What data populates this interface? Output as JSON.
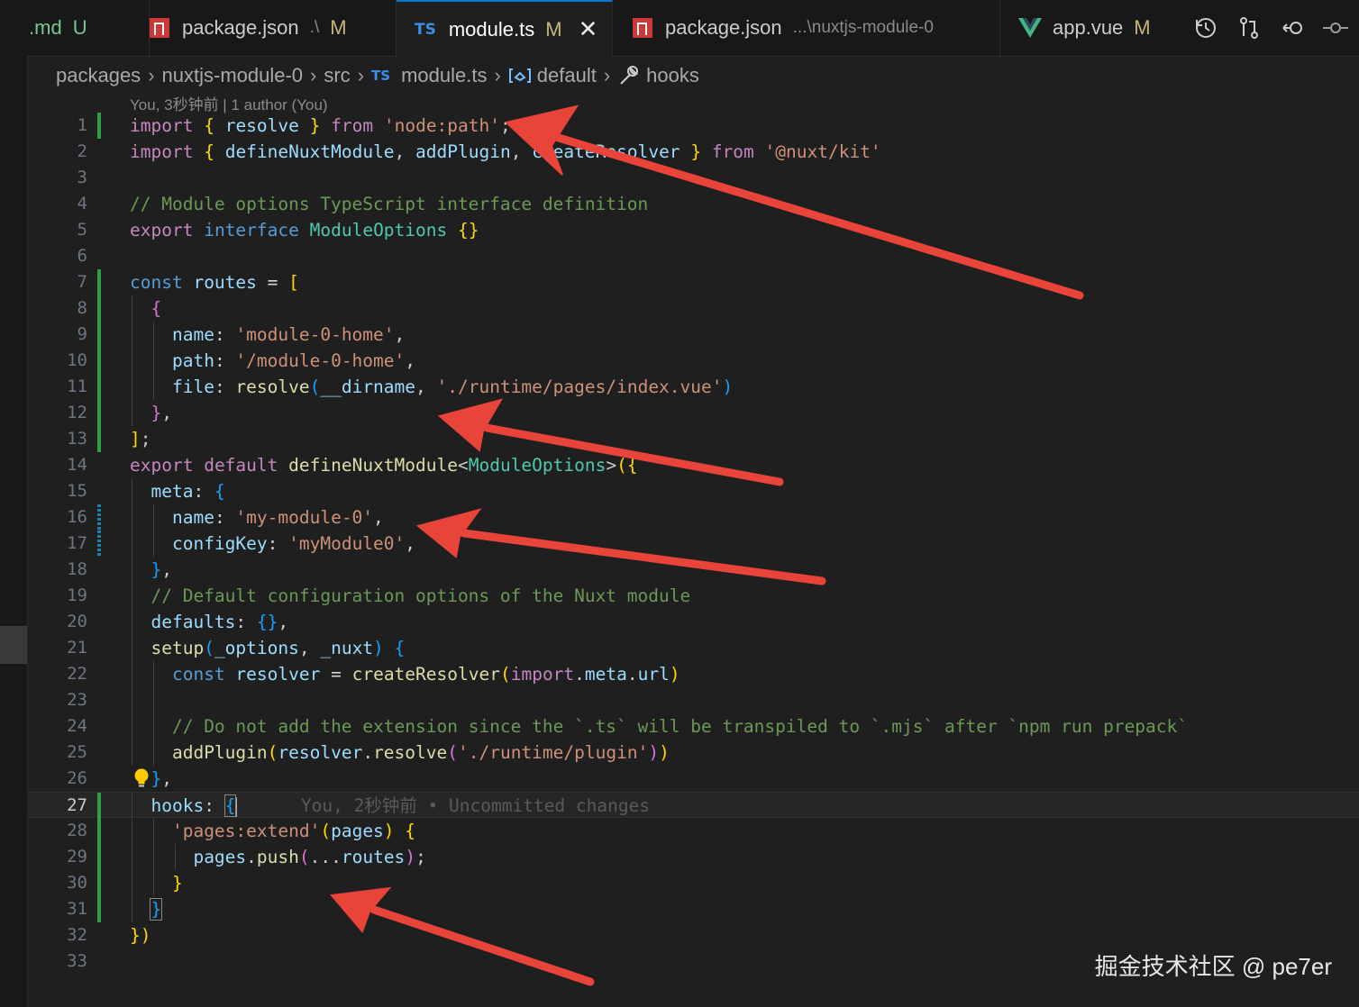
{
  "tabs": [
    {
      "icon": "markdown",
      "label": ".md",
      "status": "U"
    },
    {
      "icon": "npm-icon",
      "label": "package.json",
      "sub": ".\\",
      "status": "M"
    },
    {
      "icon": "ts",
      "label": "module.ts",
      "status": "M",
      "active": true
    },
    {
      "icon": "npm-icon",
      "label": "package.json",
      "sub": "...\\nuxtjs-module-0",
      "status": ""
    },
    {
      "icon": "vue-icon",
      "label": "app.vue",
      "status": "M"
    }
  ],
  "ts_badge": "TS",
  "close_glyph": "✕",
  "breadcrumb": {
    "items": [
      "packages",
      "nuxtjs-module-0",
      "src",
      "module.ts",
      "default",
      "hooks"
    ],
    "sep": "›"
  },
  "blame": {
    "header": "You, 3秒钟前 | 1 author (You)",
    "inline": "You, 2秒钟前 • Uncommitted changes"
  },
  "line_numbers": [
    "1",
    "2",
    "3",
    "4",
    "5",
    "6",
    "7",
    "8",
    "9",
    "10",
    "11",
    "12",
    "13",
    "14",
    "15",
    "16",
    "17",
    "18",
    "19",
    "20",
    "21",
    "22",
    "23",
    "24",
    "25",
    "26",
    "27",
    "28",
    "29",
    "30",
    "31",
    "32",
    "33"
  ],
  "current_line": "27",
  "watermark": "掘金技术社区 @ pe7er",
  "colors": {
    "accent": "#0078d4",
    "arrow": "#e8443a",
    "added": "#2ea043",
    "modified": "#1b81a8"
  }
}
